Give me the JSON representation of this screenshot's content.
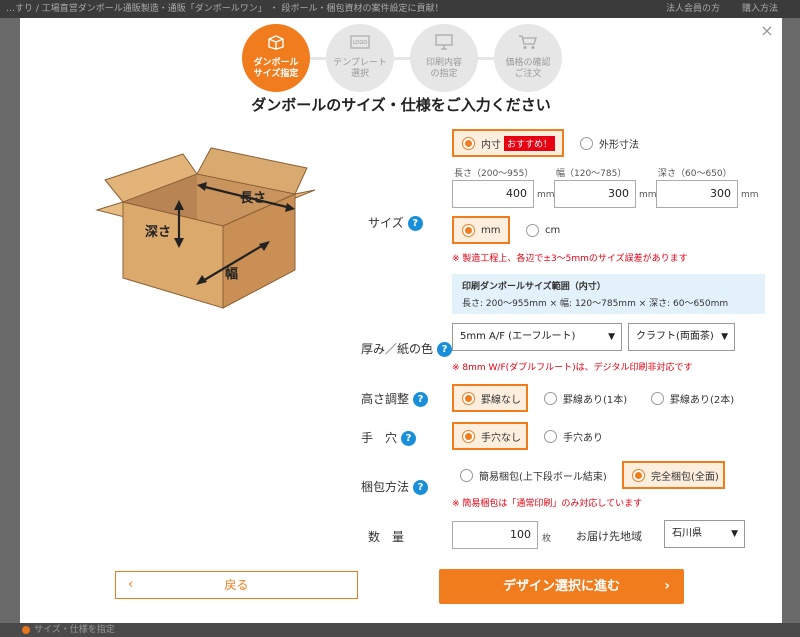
{
  "background": {
    "top_text": "…すり / 工場直営ダンボール通販製造・通販「ダンボールワン」 ・ 段ボール・梱包資材の案件設定に貢献！",
    "top_right_1": "法人会員の方",
    "top_right_2": "購入方法",
    "bottom_text": "サイズ・仕様を指定"
  },
  "modal": {
    "close": "×",
    "steps": [
      {
        "label_1": "ダンボール",
        "label_2": "サイズ指定",
        "active": true
      },
      {
        "label_1": "テンプレート",
        "label_2": "選択",
        "active": false
      },
      {
        "label_1": "印刷内容",
        "label_2": "の指定",
        "active": false
      },
      {
        "label_1": "価格の確認",
        "label_2": "ご注文",
        "active": false
      }
    ],
    "title": "ダンボールのサイズ・仕様をご入力ください",
    "illustration": {
      "length": "長さ",
      "width": "幅",
      "depth": "深さ",
      "logo": "LOGO"
    }
  },
  "form": {
    "size": {
      "label": "サイズ",
      "help": "?",
      "type_options": [
        "内寸",
        "外形寸法"
      ],
      "recommend_badge": "おすすめ！",
      "length_label": "長さ（200～955）",
      "width_label": "幅（120～785）",
      "depth_label": "深さ（60～650）",
      "length_value": "400",
      "width_value": "300",
      "depth_value": "300",
      "unit": "mm",
      "unit_options": [
        "mm",
        "cm"
      ],
      "note": "※ 製造工程上、各辺で±3～5mmのサイズ誤差があります",
      "range_title": "印刷ダンボールサイズ範囲（内寸）",
      "range_text": "長さ: 200～955mm × 幅: 120～785mm × 深さ: 60～650mm"
    },
    "thickness": {
      "label": "厚み／紙の色",
      "help": "?",
      "flute_value": "5mm A/F (エーフルート)",
      "color_value": "クラフト(両面茶)",
      "note": "※ 8mm W/F(ダブルフルート)は、デジタル印刷非対応です"
    },
    "height_adjust": {
      "label": "高さ調整",
      "help": "?",
      "options": [
        "罫線なし",
        "罫線あり(1本)",
        "罫線あり(2本)"
      ]
    },
    "hand_hole": {
      "label": "手　穴",
      "help": "?",
      "options": [
        "手穴なし",
        "手穴あり"
      ]
    },
    "packing": {
      "label": "梱包方法",
      "help": "?",
      "options": [
        "簡易梱包(上下段ボール結束)",
        "完全梱包(全面)"
      ],
      "note": "※ 簡易梱包は「通常印刷」のみ対応しています"
    },
    "quantity": {
      "label": "数　量",
      "value": "100",
      "unit": "枚",
      "region_label": "お届け先地域",
      "region_value": "石川県"
    }
  },
  "footer": {
    "back_label": "戻る",
    "next_label": "デザイン選択に進む"
  },
  "colors": {
    "accent": "#f07c1e",
    "help": "#1a8fd9",
    "warning": "#e60012",
    "info_bg": "#e3f1fb"
  }
}
